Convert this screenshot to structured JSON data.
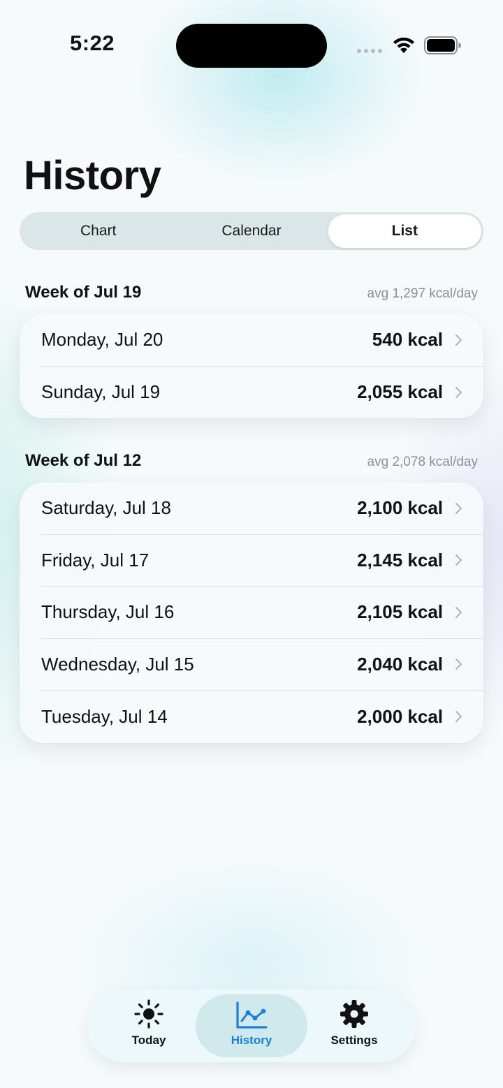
{
  "status_bar": {
    "time": "5:22"
  },
  "title": "History",
  "segments": [
    {
      "label": "Chart",
      "active": false
    },
    {
      "label": "Calendar",
      "active": false
    },
    {
      "label": "List",
      "active": true
    }
  ],
  "sections": [
    {
      "title": "Week of Jul 19",
      "avg": "avg 1,297 kcal/day",
      "rows": [
        {
          "day": "Monday, Jul 20",
          "kcal": "540 kcal"
        },
        {
          "day": "Sunday, Jul 19",
          "kcal": "2,055 kcal"
        }
      ]
    },
    {
      "title": "Week of Jul 12",
      "avg": "avg 2,078 kcal/day",
      "rows": [
        {
          "day": "Saturday, Jul 18",
          "kcal": "2,100 kcal"
        },
        {
          "day": "Friday, Jul 17",
          "kcal": "2,145 kcal"
        },
        {
          "day": "Thursday, Jul 16",
          "kcal": "2,105 kcal"
        },
        {
          "day": "Wednesday, Jul 15",
          "kcal": "2,040 kcal"
        },
        {
          "day": "Tuesday, Jul 14",
          "kcal": "2,000 kcal"
        }
      ]
    }
  ],
  "tabbar": {
    "items": [
      {
        "label": "Today",
        "icon": "sun-icon",
        "active": false
      },
      {
        "label": "History",
        "icon": "line-chart-icon",
        "active": true
      },
      {
        "label": "Settings",
        "icon": "gear-icon",
        "active": false
      }
    ]
  },
  "colors": {
    "accent": "#1a7fe0",
    "text": "#111111",
    "secondary": "#8e8e93"
  }
}
